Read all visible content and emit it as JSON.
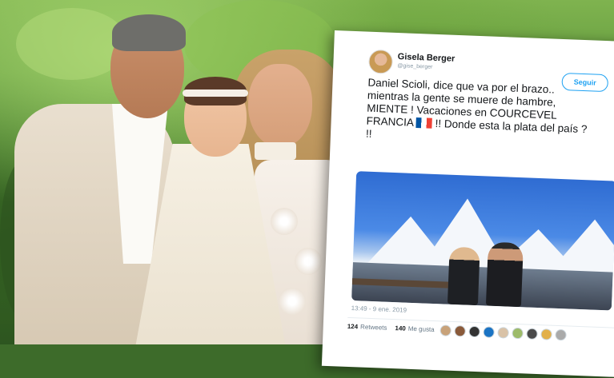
{
  "tweet": {
    "display_name": "Gisela Berger",
    "handle": "@gise_berger",
    "follow_label": "Seguir",
    "text_lines": [
      "Daniel Scioli, dice que va por el brazo..",
      "mientras la gente se muere de hambre,",
      "MIENTE ! Vacaciones en COURCEVEL",
      "!! Donde esta la plata del país ?",
      "!!"
    ],
    "text_prefix_flag_line": "FRANCIA",
    "timestamp": "13:49 - 9 ene. 2019",
    "retweets_count": "124",
    "retweets_label": "Retweets",
    "likes_count": "140",
    "likes_label": "Me gusta"
  },
  "icons": {
    "flag": "france-flag-emoji",
    "avatar": "user-avatar"
  },
  "colors": {
    "accent": "#1da1f2",
    "text": "#14171a",
    "muted": "#8899a6"
  }
}
